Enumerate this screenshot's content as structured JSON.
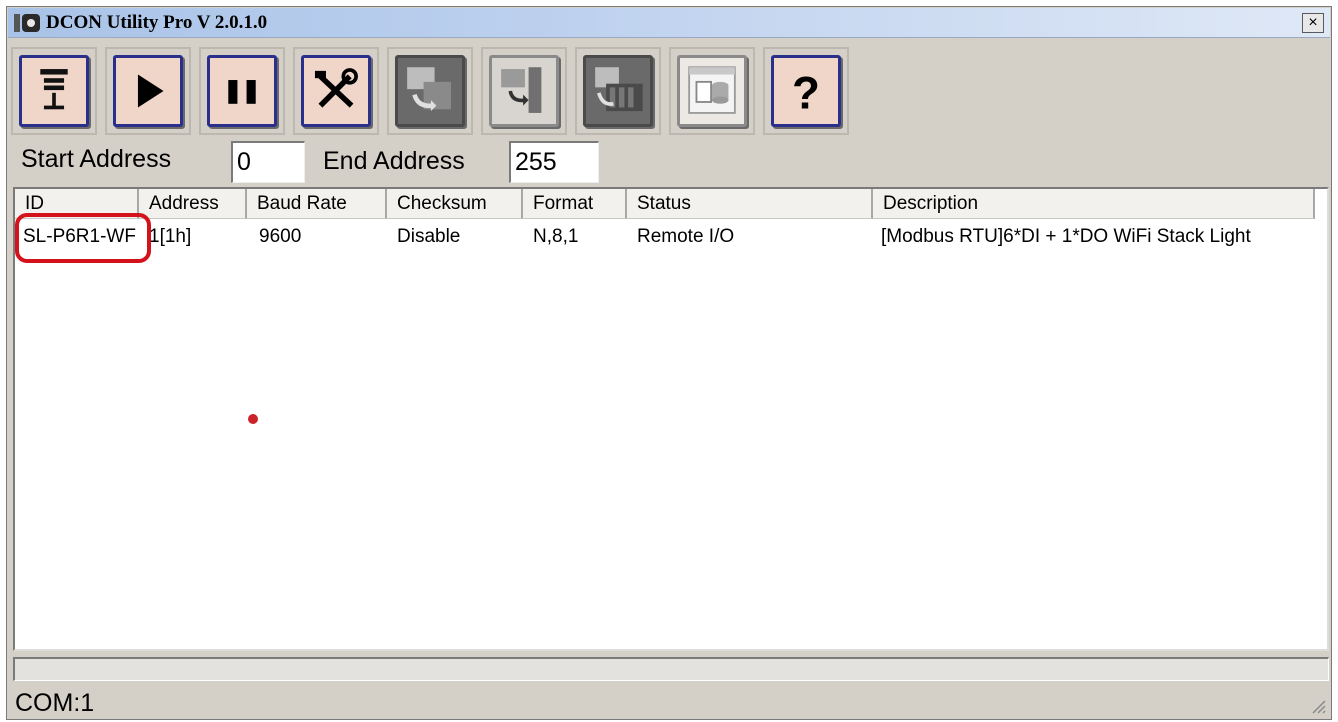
{
  "window": {
    "title": "DCON Utility Pro V 2.0.1.0",
    "close_label": "×"
  },
  "toolbar": {
    "buttons": [
      {
        "name": "com-port-icon",
        "enabled": true
      },
      {
        "name": "search-play-icon",
        "enabled": true
      },
      {
        "name": "pause-icon",
        "enabled": true
      },
      {
        "name": "tools-icon",
        "enabled": true
      },
      {
        "name": "module-config-icon",
        "enabled": false
      },
      {
        "name": "firmware-update-icon",
        "enabled": false
      },
      {
        "name": "rack-module-icon",
        "enabled": false
      },
      {
        "name": "database-icon",
        "enabled": false
      },
      {
        "name": "help-icon",
        "enabled": true,
        "glyph": "?"
      }
    ]
  },
  "address": {
    "start_label": "Start Address",
    "start_value": "0",
    "end_label": "End Address",
    "end_value": "255"
  },
  "table": {
    "columns": [
      "ID",
      "Address",
      "Baud Rate",
      "Checksum",
      "Format",
      "Status",
      "Description"
    ],
    "rows": [
      {
        "id": "SL-P6R1-WF",
        "address": "1[1h]",
        "baud_rate": "9600",
        "checksum": "Disable",
        "format": "N,8,1",
        "status": "Remote I/O",
        "description": "[Modbus RTU]6*DI + 1*DO WiFi Stack Light"
      }
    ]
  },
  "statusbar": {
    "com": "COM:1"
  },
  "colors": {
    "titlebar": "#bcd0ee",
    "button_face": "#f0d6c8",
    "button_border": "#2a2f8c",
    "highlight": "#d4121c"
  }
}
